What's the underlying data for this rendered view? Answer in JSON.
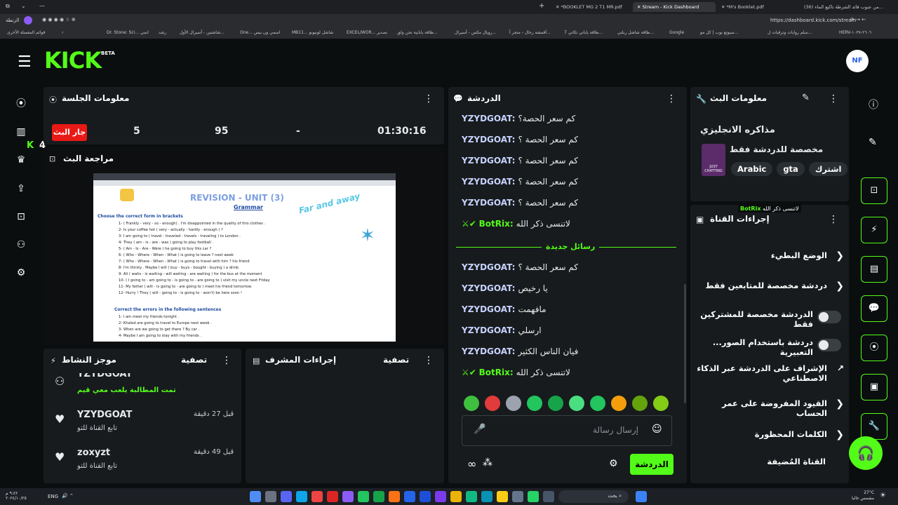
{
  "browser": {
    "tabs": [
      {
        "label": "*BOOKLET MG 2 T1 MR.pdf",
        "active": false
      },
      {
        "label": "Stream - Kick Dashboard",
        "active": true
      },
      {
        "label": "*M's Booklet.pdf",
        "active": false
      },
      {
        "label": "(36) من جنوب قائد الشرطة تاكيع الماء...",
        "active": false
      }
    ],
    "url": "https://dashboard.kick.com/stream",
    "profile": "الزنطة",
    "bookmarks": [
      "Dr. Stone: Sci... انمي",
      "رشد",
      "شاشتين - أسيرال الأول...",
      "One... اسمي ون بيس",
      "MB11... شاشل لونيونو",
      "EXCEL/WOR... تصدير",
      "طاقة يابانية نحن ولق...",
      "رويال مكس - أسيرال...",
      "أقمشة رحال - متجر أ...",
      "طاقة ياباني تكاني 7...",
      "طاقة شاشل ربلتي...",
      "Google",
      "سيوتع يوب | كل مو...",
      "سلم روايات وترقيات ل...",
      "HERV-٢٦٠٦-١٠٣٧",
      "قوائم المفضلة الأخرى"
    ]
  },
  "header": {
    "logo": "KICK",
    "logo_badge": "BETA",
    "avatar_initials": "NF"
  },
  "left_nav": {
    "notification_count": "4"
  },
  "session": {
    "title": "معلومات الجلسة",
    "status_label": "جار البث",
    "stats": [
      "5",
      "95",
      "-",
      "01:30:16"
    ]
  },
  "preview": {
    "title": "مراجعة البث",
    "slide_heading": "REVISION - UNIT (3)",
    "slide_subheading": "Grammar",
    "slide_script": "Far and away",
    "slide_instruction": "Choose the correct form in brackets",
    "slide_lines": [
      "1- ( Frankly - very - so - enough) . I'm disappointed in the quality of this clothes .",
      "2- Is your coffee hot ( very - actually - hardly - enough ) ?",
      "3- I am going to ( travel - traveled - travels - traveling ) to London .",
      "4- They ( am - is - are - was ) going to play football .",
      "5- ( Am - Is - Are - Were ) he going to buy this car ?",
      "6- ( Who - Where - When - What ) is going to leave ? next week",
      "7- ( Who - Where - When - What ) is going to travel with him ? his friend",
      "8- I'm thirsty . Maybe I will ( buy - buys - bought - buying ) a drink.",
      "9- Ali ( waits - is waiting - will waiting - are waiting ) for the bus at the moment",
      "10- ( I going to - am going to - is going to - are going to ) visit my uncle next Friday",
      "11- My father ( will - is going to - are going to ) meet his friend tomorrow.",
      "12- Hurry ! They ( will - going to - is going to - won't) be here soon !"
    ],
    "slide_errors_heading": "Correct the errors in the following sentences",
    "slide_errors": [
      "1- I am meet my friends tonight .",
      "2- Khaled are going to travel to Europe next week .",
      "3- When are we going to get there ? By car .",
      "4- Maybe I am going to stay with my friends ."
    ]
  },
  "chat": {
    "title": "الدردشة",
    "messages_before": [
      {
        "user": "YZYDGOAT:",
        "text": "كم سعر الحصة؟",
        "bot": false
      },
      {
        "user": "YZYDGOAT:",
        "text": "كم سعر الحصة ؟",
        "bot": false
      },
      {
        "user": "YZYDGOAT:",
        "text": "كم سعر الحصة ؟",
        "bot": false
      },
      {
        "user": "YZYDGOAT:",
        "text": "كم سعر الحصة ؟",
        "bot": false
      },
      {
        "user": "YZYDGOAT:",
        "text": "كم سعر الحصة ؟",
        "bot": false
      },
      {
        "user": "BotRix:",
        "text": "لاتنسى ذكر الله",
        "bot": true
      }
    ],
    "new_messages_label": "رسائل جديدة",
    "messages_after": [
      {
        "user": "YZYDGOAT:",
        "text": "كم سعر الحصة ؟",
        "bot": false
      },
      {
        "user": "YZYDGOAT:",
        "text": "يا رخيص",
        "bot": false
      },
      {
        "user": "YZYDGOAT:",
        "text": "مافهمت",
        "bot": false
      },
      {
        "user": "YZYDGOAT:",
        "text": "ارسلي",
        "bot": false
      },
      {
        "user": "YZYDGOAT:",
        "text": "فيان الناس الكثير",
        "bot": false
      },
      {
        "user": "BotRix:",
        "text": "لاتنسى ذكر الله",
        "bot": true
      }
    ],
    "input_placeholder": "إرسال رسالة",
    "send_label": "الدردشة"
  },
  "activity": {
    "title": "موجز النشاط",
    "filter_label": "تصفية",
    "items": [
      {
        "user": "YZYDGOAT",
        "time": "",
        "desc": "تمت المطالبة يلعب معي قيم",
        "highlight": true
      },
      {
        "user": "YZYDGOAT",
        "time": "قبل 27 دقيقة",
        "desc": "تابع القناة للتو",
        "highlight": false
      },
      {
        "user": "zoxyzt",
        "time": "قبل 49 دقيقة",
        "desc": "تابع القناة للتو",
        "highlight": false
      }
    ]
  },
  "moderator": {
    "title": "إجراءات المشرف",
    "filter_label": "تصفية"
  },
  "stream_info": {
    "title": "معلومات البث",
    "stream_title": "مذاكره الانجليزي",
    "category": "مخصصة للدردشة فقط",
    "tags": [
      "Arabic",
      "gta",
      "اشترك"
    ]
  },
  "channel_actions": {
    "title": "إجراءات القناة",
    "tooltip": "لاتنسى ذكر الله",
    "tooltip_bot": "BotRix",
    "rows": [
      {
        "label": "الوضع البطيء",
        "control": "chevron"
      },
      {
        "label": "دردشة مخصصة للمتابعين فقط",
        "control": "chevron"
      },
      {
        "label": "الدردشة مخصصة للمشتركين فقط",
        "control": "toggle"
      },
      {
        "label": "...دردشة باستخدام الصور التعبيرية",
        "control": "toggle"
      },
      {
        "label": "الإشراف على الدردشة عبر الذكاء الاصطناعي",
        "control": "external"
      },
      {
        "label": "القيود المفروضة على عمر الحساب",
        "control": "chevron"
      },
      {
        "label": "الكلمات المحظورة",
        "control": "chevron"
      },
      {
        "label": "القناة المُضيفة",
        "control": "none"
      }
    ]
  },
  "taskbar": {
    "search_placeholder": "بحث",
    "language": "ENG",
    "weather": "27°C",
    "weather_desc": "مشمس غالبا",
    "time": "٩:٤٢ م",
    "date": "٢٠٢٤/١٠/٢٥"
  },
  "colors": {
    "accent": "#53fc18",
    "live": "#e91916",
    "panel": "#171b1d",
    "bg": "#0b0e0f"
  }
}
